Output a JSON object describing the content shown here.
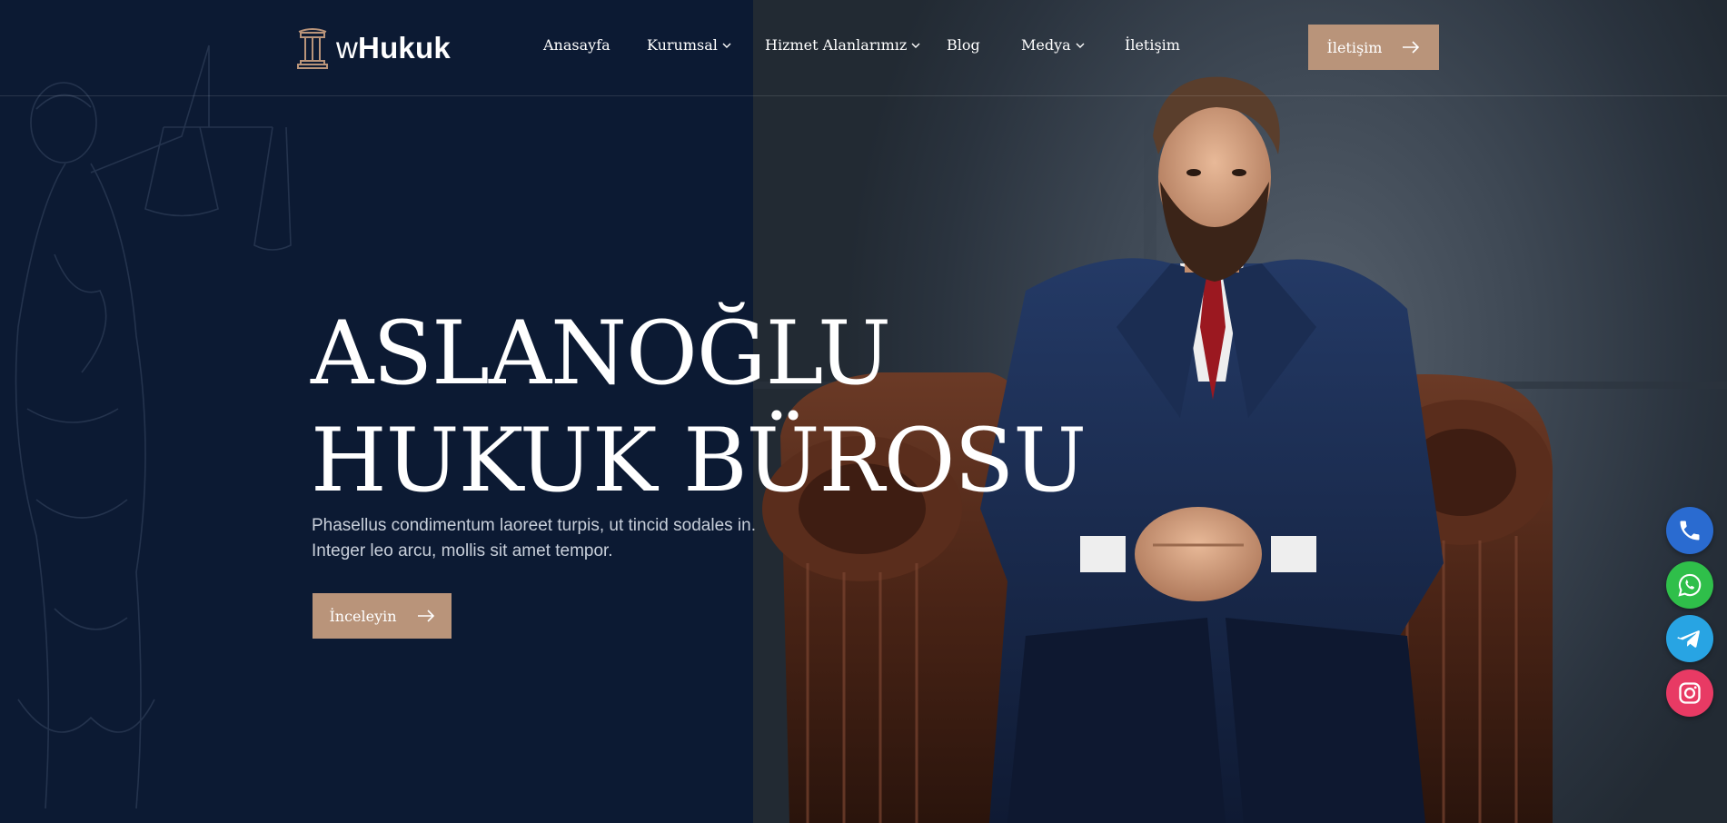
{
  "brand": {
    "prefix": "w",
    "name": "Hukuk"
  },
  "nav": {
    "items": [
      {
        "label": "Anasayfa",
        "has_dropdown": false
      },
      {
        "label": "Kurumsal",
        "has_dropdown": true
      },
      {
        "label": "Hizmet Alanlarımız",
        "has_dropdown": true
      },
      {
        "label": "Blog",
        "has_dropdown": false
      },
      {
        "label": "Medya",
        "has_dropdown": true
      },
      {
        "label": "İletişim",
        "has_dropdown": false
      }
    ],
    "cta_label": "İletişim"
  },
  "hero": {
    "title_line1": "ASLANOĞLU",
    "title_line2": "HUKUK BÜROSU",
    "subtitle": "Phasellus condimentum laoreet turpis, ut tincid sodales in. Integer leo arcu, mollis sit amet tempor.",
    "button_label": "İnceleyin"
  },
  "social": {
    "icons": [
      "phone-icon",
      "whatsapp-icon",
      "telegram-icon",
      "instagram-icon"
    ],
    "colors": {
      "phone": "#2a6bd0",
      "whatsapp": "#2fbf4a",
      "telegram": "#28a4e3",
      "instagram": "#e83a64"
    }
  },
  "colors": {
    "background": "#0c1a33",
    "accent": "#b9947a",
    "text": "#ffffff"
  }
}
